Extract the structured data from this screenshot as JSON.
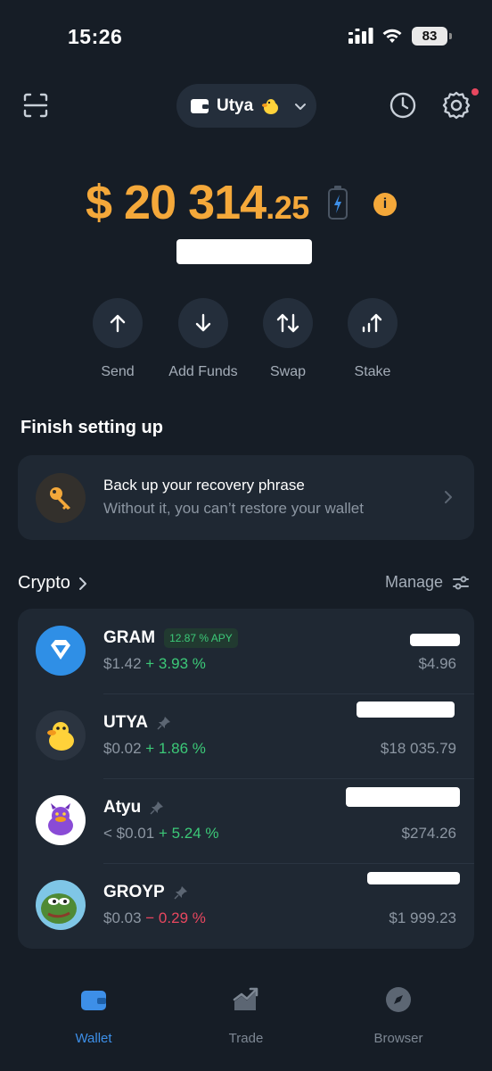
{
  "status_bar": {
    "time": "15:26",
    "battery": "83"
  },
  "header": {
    "wallet_name": "Utya"
  },
  "balance": {
    "main": "$ 20 314",
    "decimal": ".25",
    "info_glyph": "i"
  },
  "actions": [
    {
      "label": "Send",
      "icon": "arrow-up-icon"
    },
    {
      "label": "Add Funds",
      "icon": "arrow-down-icon"
    },
    {
      "label": "Swap",
      "icon": "swap-icon"
    },
    {
      "label": "Stake",
      "icon": "stake-icon"
    }
  ],
  "setup": {
    "title": "Finish setting up",
    "card_title": "Back up your recovery phrase",
    "card_subtitle": "Without it, you can’t restore your wallet"
  },
  "crypto": {
    "title": "Crypto",
    "manage_label": "Manage",
    "tokens": [
      {
        "name": "GRAM",
        "badge": "12.87 % APY",
        "price": "$1.42",
        "change": "+ 3.93 %",
        "direction": "up",
        "value": "$4.96"
      },
      {
        "name": "UTYA",
        "price": "$0.02",
        "change": "+ 1.86 %",
        "direction": "up",
        "value": "$18 035.79"
      },
      {
        "name": "Atyu",
        "price": "< $0.01",
        "change": "+ 5.24 %",
        "direction": "up",
        "value": "$274.26"
      },
      {
        "name": "GROYP",
        "price": "$0.03",
        "change": "− 0.29 %",
        "direction": "down",
        "value": "$1 999.23"
      }
    ]
  },
  "nav": {
    "wallet": "Wallet",
    "trade": "Trade",
    "browser": "Browser"
  },
  "colors": {
    "background": "#161d26",
    "card": "#1f2833",
    "accent_orange": "#f4a83a",
    "positive": "#3cc978",
    "negative": "#e8475f",
    "active_blue": "#3d8fe8"
  }
}
